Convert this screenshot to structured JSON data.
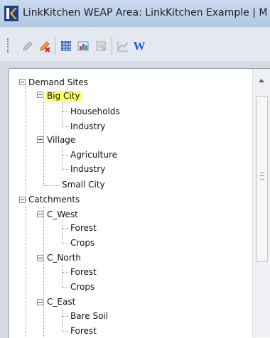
{
  "window": {
    "title": "LinkKitchen   WEAP Area: LinkKitchen Example | M"
  },
  "toolbar": {
    "buttons": [
      "pencil-icon",
      "pencil-delete-icon",
      "grid-icon",
      "chart-icon",
      "notes-icon",
      "line-chart-icon",
      "word-icon"
    ],
    "word_label": "W"
  },
  "tree": {
    "demand_sites": {
      "label": "Demand Sites",
      "big_city": {
        "label": "Big City",
        "children": [
          "Households",
          "Industry"
        ]
      },
      "village": {
        "label": "Village",
        "children": [
          "Agriculture",
          "Industry"
        ]
      },
      "small_city": {
        "label": "Small City"
      }
    },
    "catchments": {
      "label": "Catchments",
      "c_west": {
        "label": "C_West",
        "children": [
          "Forest",
          "Crops"
        ]
      },
      "c_north": {
        "label": "C_North",
        "children": [
          "Forest",
          "Crops"
        ]
      },
      "c_east": {
        "label": "C_East",
        "children": [
          "Bare Soil",
          "Forest"
        ]
      }
    }
  }
}
